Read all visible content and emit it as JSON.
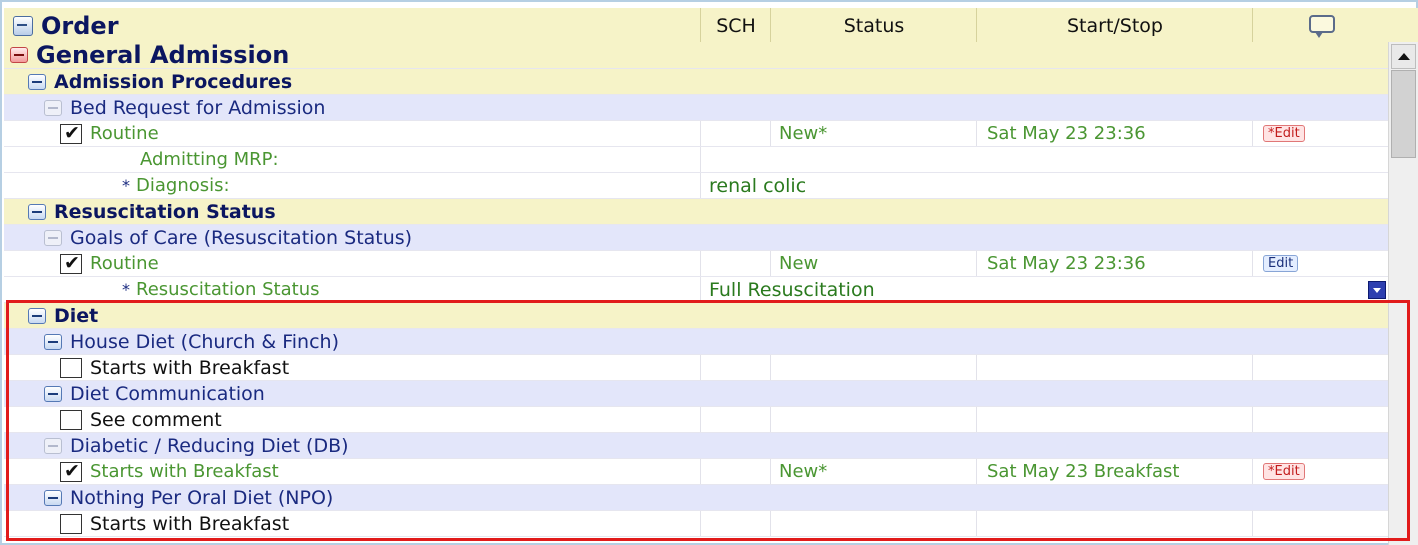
{
  "header": {
    "order": "Order",
    "sch": "SCH",
    "status": "Status",
    "start_stop": "Start/Stop"
  },
  "rows": {
    "general_admission": "General Admission",
    "admission_procedures": "Admission Procedures",
    "bed_request": "Bed Request for Admission",
    "bed_routine": "Routine",
    "bed_status": "New*",
    "bed_start": "Sat  May 23 23:36",
    "bed_edit": "*Edit",
    "admitting_mrp": "Admitting MRP:",
    "diagnosis_label": "Diagnosis:",
    "diagnosis_star": "*",
    "diagnosis_value": "renal colic",
    "resus_status": "Resuscitation Status",
    "goals_of_care": "Goals of Care (Resuscitation Status)",
    "goc_routine": "Routine",
    "goc_status": "New",
    "goc_start": "Sat  May 23 23:36",
    "goc_edit": "Edit",
    "resus_detail_star": "*",
    "resus_detail_label": "Resuscitation Status",
    "resus_detail_value": "Full Resuscitation",
    "diet": "Diet",
    "house_diet": "House Diet (Church & Finch)",
    "house_starts": "Starts with Breakfast",
    "diet_comm": "Diet Communication",
    "see_comment": "See comment",
    "diabetic_diet": "Diabetic / Reducing Diet (DB)",
    "db_starts": "Starts with Breakfast",
    "db_status": "New*",
    "db_start": "Sat  May 23 Breakfast",
    "db_edit": "*Edit",
    "npo": "Nothing Per Oral Diet (NPO)",
    "npo_starts": "Starts with Breakfast"
  },
  "colors": {
    "highlight": "#e11b1b",
    "header_bg": "#f6f3c8",
    "subgroup_bg": "#e3e6fa",
    "green_text": "#4a9632"
  }
}
